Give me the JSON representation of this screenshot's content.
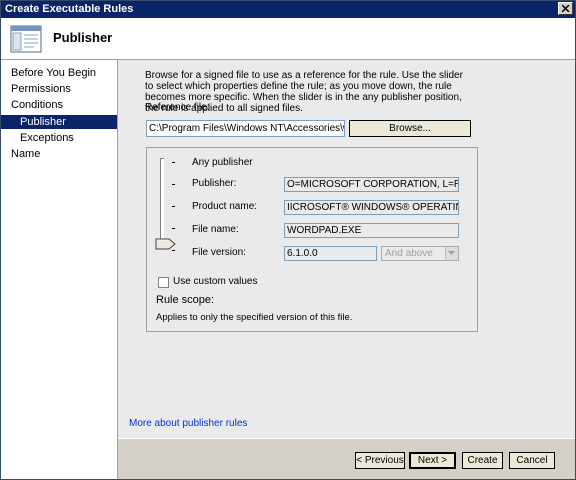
{
  "window": {
    "title": "Create Executable Rules"
  },
  "header": {
    "title": "Publisher",
    "icon": "rules-window-icon"
  },
  "nav": {
    "items": [
      {
        "label": "Before You Begin",
        "selected": false,
        "indent": false
      },
      {
        "label": "Permissions",
        "selected": false,
        "indent": false
      },
      {
        "label": "Conditions",
        "selected": false,
        "indent": false
      },
      {
        "label": "Publisher",
        "selected": true,
        "indent": true
      },
      {
        "label": "Exceptions",
        "selected": false,
        "indent": true
      },
      {
        "label": "Name",
        "selected": false,
        "indent": false
      }
    ]
  },
  "main": {
    "description": "Browse for a signed file to use as a reference for the rule. Use the slider to select which properties define the rule; as you move down, the rule becomes more specific. When the slider is in the any publisher position, the rule is applied to all signed files.",
    "reference_label": "Reference file:",
    "reference_value": "C:\\Program Files\\Windows NT\\Accessories\\wordpad.e",
    "browse_label": "Browse...",
    "levels": {
      "any": "Any publisher",
      "publisher_label": "Publisher:",
      "publisher_value": "O=MICROSOFT CORPORATION, L=REDMOND,",
      "product_label": "Product name:",
      "product_value": "IICROSOFT® WINDOWS® OPERATING SYSTEM",
      "filename_label": "File name:",
      "filename_value": "WORDPAD.EXE",
      "version_label": "File version:",
      "version_value": "6.1.0.0",
      "version_mode": "And above"
    },
    "custom_label": "Use custom values",
    "custom_checked": false,
    "rule_scope_label": "Rule scope:",
    "rule_scope_text": "Applies to only the specified version of this file.",
    "more_link": "More about publisher rules"
  },
  "buttons": {
    "previous": "< Previous",
    "next": "Next >",
    "create": "Create",
    "cancel": "Cancel"
  },
  "colors": {
    "titlebar": "#0a246a",
    "selection": "#0a246a",
    "panel": "#eaeaea",
    "link": "#0033cc"
  }
}
